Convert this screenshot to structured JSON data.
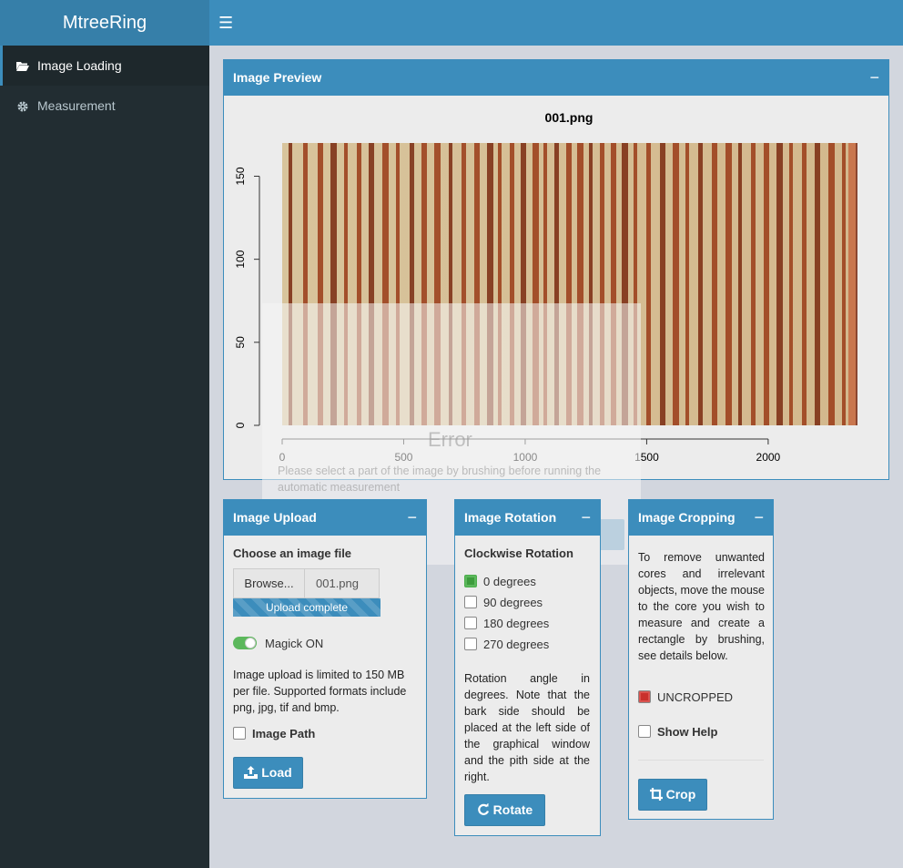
{
  "app": {
    "title": "MtreeRing"
  },
  "sidebar": {
    "items": [
      {
        "label": "Image Loading",
        "icon": "folder-open-icon",
        "active": true
      },
      {
        "label": "Measurement",
        "icon": "gear-icon",
        "active": false
      }
    ]
  },
  "preview": {
    "title": "Image Preview",
    "collapse": "−",
    "plot_title": "001.png"
  },
  "chart_data": {
    "type": "image",
    "title": "001.png",
    "x_ticks": [
      "0",
      "500",
      "1000",
      "1500",
      "2000"
    ],
    "y_ticks": [
      "0",
      "50",
      "100",
      "150"
    ],
    "xlim": [
      0,
      2360
    ],
    "ylim": [
      0,
      170
    ]
  },
  "error": {
    "title": "Error",
    "message": "Please select a part of the image by brushing before running the automatic measurement"
  },
  "upload": {
    "title": "Image Upload",
    "collapse": "−",
    "file_label": "Choose an image file",
    "browse": "Browse...",
    "filename": "001.png",
    "progress": "Upload complete",
    "progress_value": 1.0,
    "magick": "Magick ON",
    "note": "Image upload is limited to 150 MB per file. Supported formats include png, jpg, tif and bmp.",
    "image_path": "Image Path",
    "load": "Load"
  },
  "rotation": {
    "title": "Image Rotation",
    "collapse": "−",
    "label": "Clockwise Rotation",
    "options": [
      "0 degrees",
      "90 degrees",
      "180 degrees",
      "270 degrees"
    ],
    "selected": "0 degrees",
    "note": "Rotation angle in degrees. Note that the bark side should be placed at the left side of the graphical window and the pith side at the right.",
    "button": "Rotate"
  },
  "cropping": {
    "title": "Image Cropping",
    "collapse": "−",
    "note": "To remove unwanted cores and irrelevant objects, move the mouse to the core you wish to measure and create a rectangle by brushing, see details below.",
    "status": "UNCROPPED",
    "help": "Show Help",
    "button": "Crop"
  },
  "colors": {
    "primary": "#3c8dbc",
    "sidebar": "#222d32",
    "success": "#5cb85c",
    "danger": "#d9534f"
  }
}
